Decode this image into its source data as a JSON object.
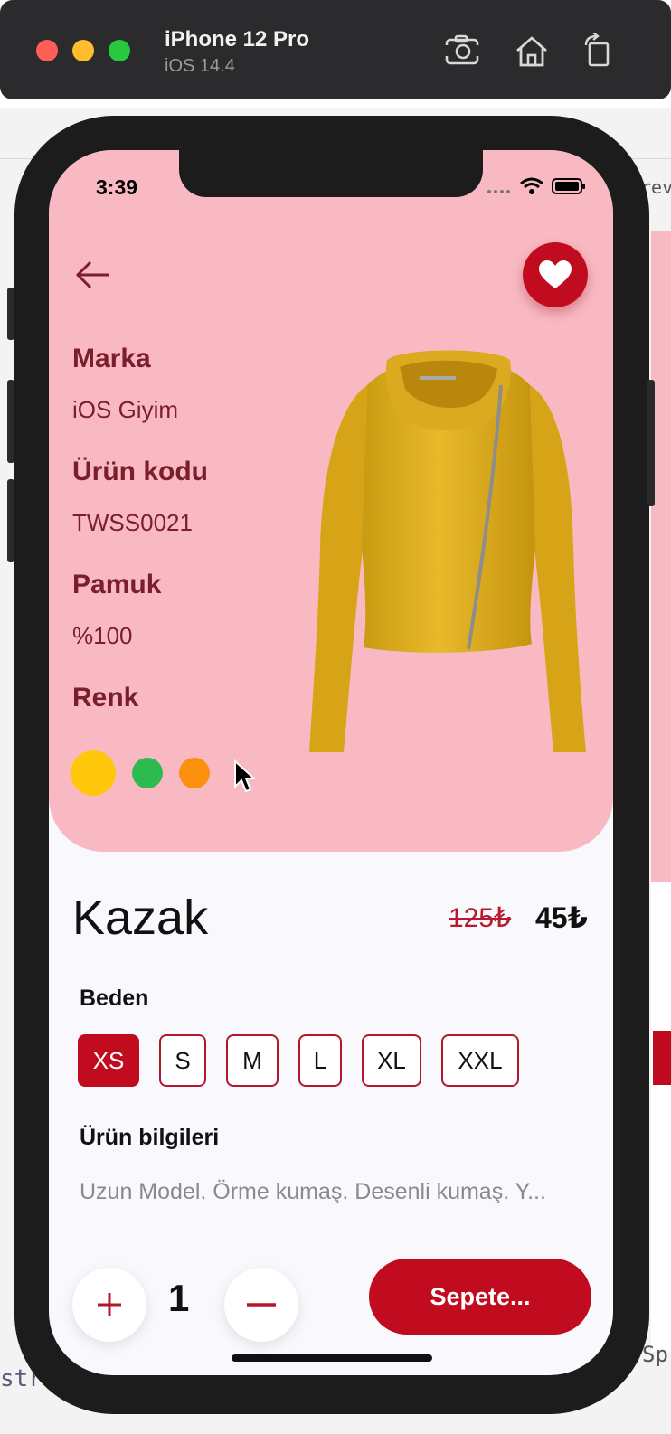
{
  "simulator": {
    "device_name": "iPhone 12 Pro",
    "os_version": "iOS 14.4",
    "icons": [
      "screenshot-icon",
      "home-icon",
      "rotate-icon"
    ]
  },
  "background": {
    "peek_top_text": "rev",
    "peek_bottom_text": "Sp",
    "left_code_text": "str"
  },
  "status_bar": {
    "time": "3:39",
    "icons": [
      "signal-icon",
      "wifi-icon",
      "battery-icon"
    ]
  },
  "product": {
    "specs": [
      {
        "label": "Marka",
        "value": "iOS Giyim"
      },
      {
        "label": "Ürün kodu",
        "value": "TWSS0021"
      },
      {
        "label": "Pamuk",
        "value": "%100"
      }
    ],
    "color_label": "Renk",
    "colors": [
      "#ffc709",
      "#2dba4e",
      "#fb8f0e"
    ],
    "selected_color": 0,
    "title": "Kazak",
    "old_price": "125₺",
    "new_price": "45₺",
    "size_label": "Beden",
    "sizes": [
      "XS",
      "S",
      "M",
      "L",
      "XL",
      "XXL"
    ],
    "selected_size": "XS",
    "info_label": "Ürün bilgileri",
    "description": "Uzun Model. Örme kumaş. Desenli kumaş. Y..."
  },
  "cart": {
    "quantity": "1",
    "add_label": "Sepete..."
  },
  "theme": {
    "accent": "#c10b1e",
    "hero_bg": "#f9b9c2",
    "label_color": "#7a1d2c"
  }
}
